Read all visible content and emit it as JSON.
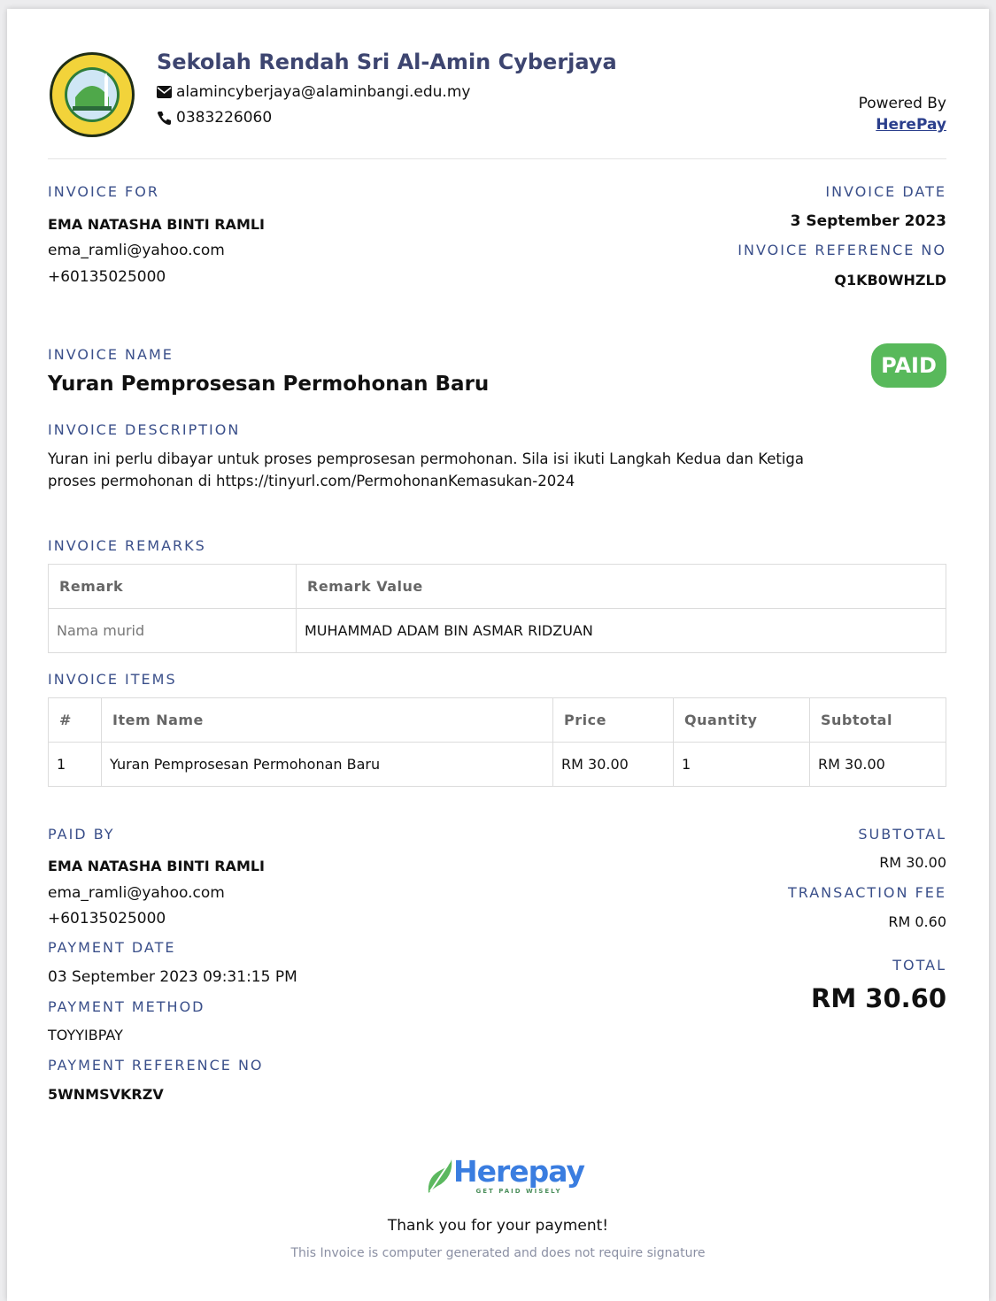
{
  "school": {
    "name": "Sekolah Rendah Sri Al-Amin Cyberjaya",
    "email": "alamincyberjaya@alaminbangi.edu.my",
    "phone": "0383226060"
  },
  "powered": {
    "label": "Powered By",
    "link": "HerePay"
  },
  "invoice_for": {
    "label": "INVOICE FOR",
    "name": "EMA NATASHA BINTI RAMLI",
    "email": "ema_ramli@yahoo.com",
    "phone": "+60135025000"
  },
  "invoice_date": {
    "label": "INVOICE DATE",
    "value": "3 September 2023"
  },
  "invoice_ref": {
    "label": "INVOICE REFERENCE NO",
    "value": "Q1KB0WHZLD"
  },
  "invoice_name": {
    "label": "INVOICE NAME",
    "value": "Yuran Pemprosesan Permohonan Baru"
  },
  "status": "PAID",
  "description": {
    "label": "INVOICE DESCRIPTION",
    "line1": "Yuran ini perlu dibayar untuk proses pemprosesan permohonan. Sila isi ikuti Langkah Kedua dan Ketiga",
    "line2": "proses permohonan di https://tinyurl.com/PermohonanKemasukan-2024"
  },
  "remarks": {
    "label": "INVOICE REMARKS",
    "headers": [
      "Remark",
      "Remark Value"
    ],
    "rows": [
      [
        "Nama murid",
        "MUHAMMAD ADAM BIN ASMAR RIDZUAN"
      ]
    ]
  },
  "items": {
    "label": "INVOICE ITEMS",
    "headers": [
      "#",
      "Item Name",
      "Price",
      "Quantity",
      "Subtotal"
    ],
    "rows": [
      [
        "1",
        "Yuran Pemprosesan Permohonan Baru",
        "RM 30.00",
        "1",
        "RM 30.00"
      ]
    ]
  },
  "paid_by": {
    "label": "PAID BY",
    "name": "EMA NATASHA BINTI RAMLI",
    "email": "ema_ramli@yahoo.com",
    "phone": "+60135025000"
  },
  "payment_date": {
    "label": "PAYMENT DATE",
    "value": "03 September 2023 09:31:15 PM"
  },
  "payment_method": {
    "label": "PAYMENT METHOD",
    "value": "TOYYIBPAY"
  },
  "payment_ref": {
    "label": "PAYMENT REFERENCE NO",
    "value": "5WNMSVKRZV"
  },
  "totals": {
    "subtotal_label": "SUBTOTAL",
    "subtotal": "RM 30.00",
    "fee_label": "TRANSACTION FEE",
    "fee": "RM 0.60",
    "total_label": "TOTAL",
    "total": "RM 30.60"
  },
  "footer": {
    "brand": "Herepay",
    "tagline": "GET PAID WISELY",
    "thanks": "Thank you for your payment!",
    "note": "This Invoice is computer generated and does not require signature"
  },
  "colors": {
    "label": "#3a4f8a",
    "paid": "#58b95b",
    "brand": "#3a7de0"
  }
}
